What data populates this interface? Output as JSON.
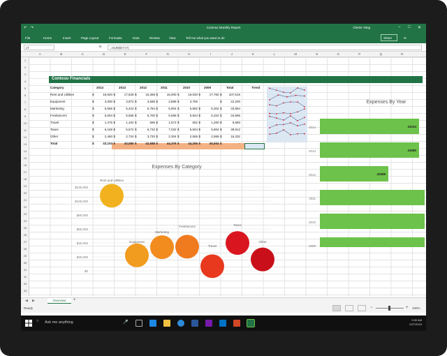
{
  "window": {
    "doc_title": "Contoso Monthly Report",
    "user": "Cherie Yang",
    "minimize": "–",
    "maximize": "□",
    "close": "✕",
    "qat_save": "↶",
    "qat_redo": "↷"
  },
  "ribbon": {
    "tabs": [
      "File",
      "Home",
      "Insert",
      "Page Layout",
      "Formulas",
      "Data",
      "Review",
      "View"
    ],
    "tell_me": "Tell me what you want to do",
    "share": "Share"
  },
  "formula_bar": {
    "name_box": "J7",
    "fx": "fx",
    "formula": "=SUM(D7:I7)"
  },
  "columns": [
    "A",
    "B",
    "C",
    "D",
    "E",
    "F",
    "G",
    "H",
    "I",
    "J",
    "K",
    "L",
    "M",
    "N",
    "O",
    "P",
    "Q",
    "R"
  ],
  "rows": [
    "1",
    "2",
    "3",
    "4",
    "5",
    "6",
    "7",
    "8",
    "9",
    "10",
    "11",
    "12",
    "13",
    "14",
    "15",
    "16",
    "17",
    "18",
    "19",
    "20",
    "21",
    "22",
    "23",
    "24",
    "25",
    "26",
    "27",
    "28",
    "29",
    "30",
    "31",
    "32",
    "33",
    "34"
  ],
  "table": {
    "title": "Contoso Financials",
    "headers": [
      "Category",
      "2014",
      "2013",
      "2012",
      "2011",
      "2010",
      "2009",
      "Total",
      "Trend"
    ],
    "rows": [
      [
        "Rent and Utilities",
        "$",
        "18,840",
        "$",
        "17,628",
        "$",
        "16,368",
        "$",
        "16,000",
        "$",
        "19,020",
        "$",
        "17,760",
        "$",
        "107,616"
      ],
      [
        "Equipment",
        "$",
        "3,000",
        "$",
        "3,972",
        "$",
        "3,588",
        "$",
        "3,888",
        "$",
        "3,756",
        "$",
        "22,200"
      ],
      [
        "Marketing",
        "$",
        "5,556",
        "$",
        "5,424",
        "$",
        "5,784",
        "$",
        "5,904",
        "$",
        "5,892",
        "$",
        "5,304",
        "$",
        "33,864"
      ],
      [
        "Freelancers",
        "$",
        "5,604",
        "$",
        "5,556",
        "$",
        "5,700",
        "$",
        "5,568",
        "$",
        "5,844",
        "$",
        "6,324",
        "$",
        "34,596"
      ],
      [
        "Travel",
        "$",
        "1,476",
        "$",
        "1,104",
        "$",
        "696",
        "$",
        "1,572",
        "$",
        "552",
        "$",
        "1,260",
        "$",
        "6,660"
      ],
      [
        "Taxes",
        "$",
        "6,168",
        "$",
        "6,672",
        "$",
        "6,732",
        "$",
        "7,032",
        "$",
        "6,504",
        "$",
        "6,804",
        "$",
        "39,912"
      ],
      [
        "Other",
        "$",
        "2,460",
        "$",
        "2,724",
        "$",
        "3,720",
        "$",
        "2,304",
        "$",
        "2,556",
        "$",
        "2,568",
        "$",
        "16,332"
      ],
      [
        "Total",
        "$",
        "43,104",
        "$",
        "43,080",
        "$",
        "42,588",
        "$",
        "44,376",
        "$",
        "44,256",
        "$",
        "45,504",
        "$",
        "-"
      ]
    ]
  },
  "chart_category": {
    "title": "Expenses By Category",
    "type": "scatter",
    "y_ticks": [
      "$120,000",
      "$100,000",
      "$80,000",
      "$60,000",
      "$40,000",
      "$20,000",
      "$0"
    ],
    "ylim": [
      0,
      120000
    ],
    "points": [
      {
        "label": "Rent and Utilities",
        "value": 107616,
        "color": "#f2b21f"
      },
      {
        "label": "Equipment",
        "value": 22200,
        "color": "#f29c1f"
      },
      {
        "label": "Marketing",
        "value": 33864,
        "color": "#f28c1f"
      },
      {
        "label": "Freelancers",
        "value": 34596,
        "color": "#f07b1f"
      },
      {
        "label": "Travel",
        "value": 6660,
        "color": "#e8391f"
      },
      {
        "label": "Taxes",
        "value": 39912,
        "color": "#d9161f"
      },
      {
        "label": "Other",
        "value": 16332,
        "color": "#c9101a"
      }
    ]
  },
  "chart_year": {
    "title": "Expenses By Year",
    "type": "bar",
    "categories": [
      "2014",
      "2013",
      "2012",
      "2011",
      "2010",
      "2009"
    ],
    "values": [
      43104,
      43080,
      42588,
      44376,
      44256,
      45504
    ],
    "data_labels": [
      "43104",
      "43080",
      "42588",
      "",
      "",
      ""
    ],
    "color": "#6cc24a"
  },
  "sheets": {
    "active": "Overview",
    "add": "+"
  },
  "status": {
    "ready": "Ready",
    "zoom": "100%"
  },
  "taskbar": {
    "search": "Ask me anything",
    "time": "9:30 AM",
    "date": "2/27/2015"
  }
}
